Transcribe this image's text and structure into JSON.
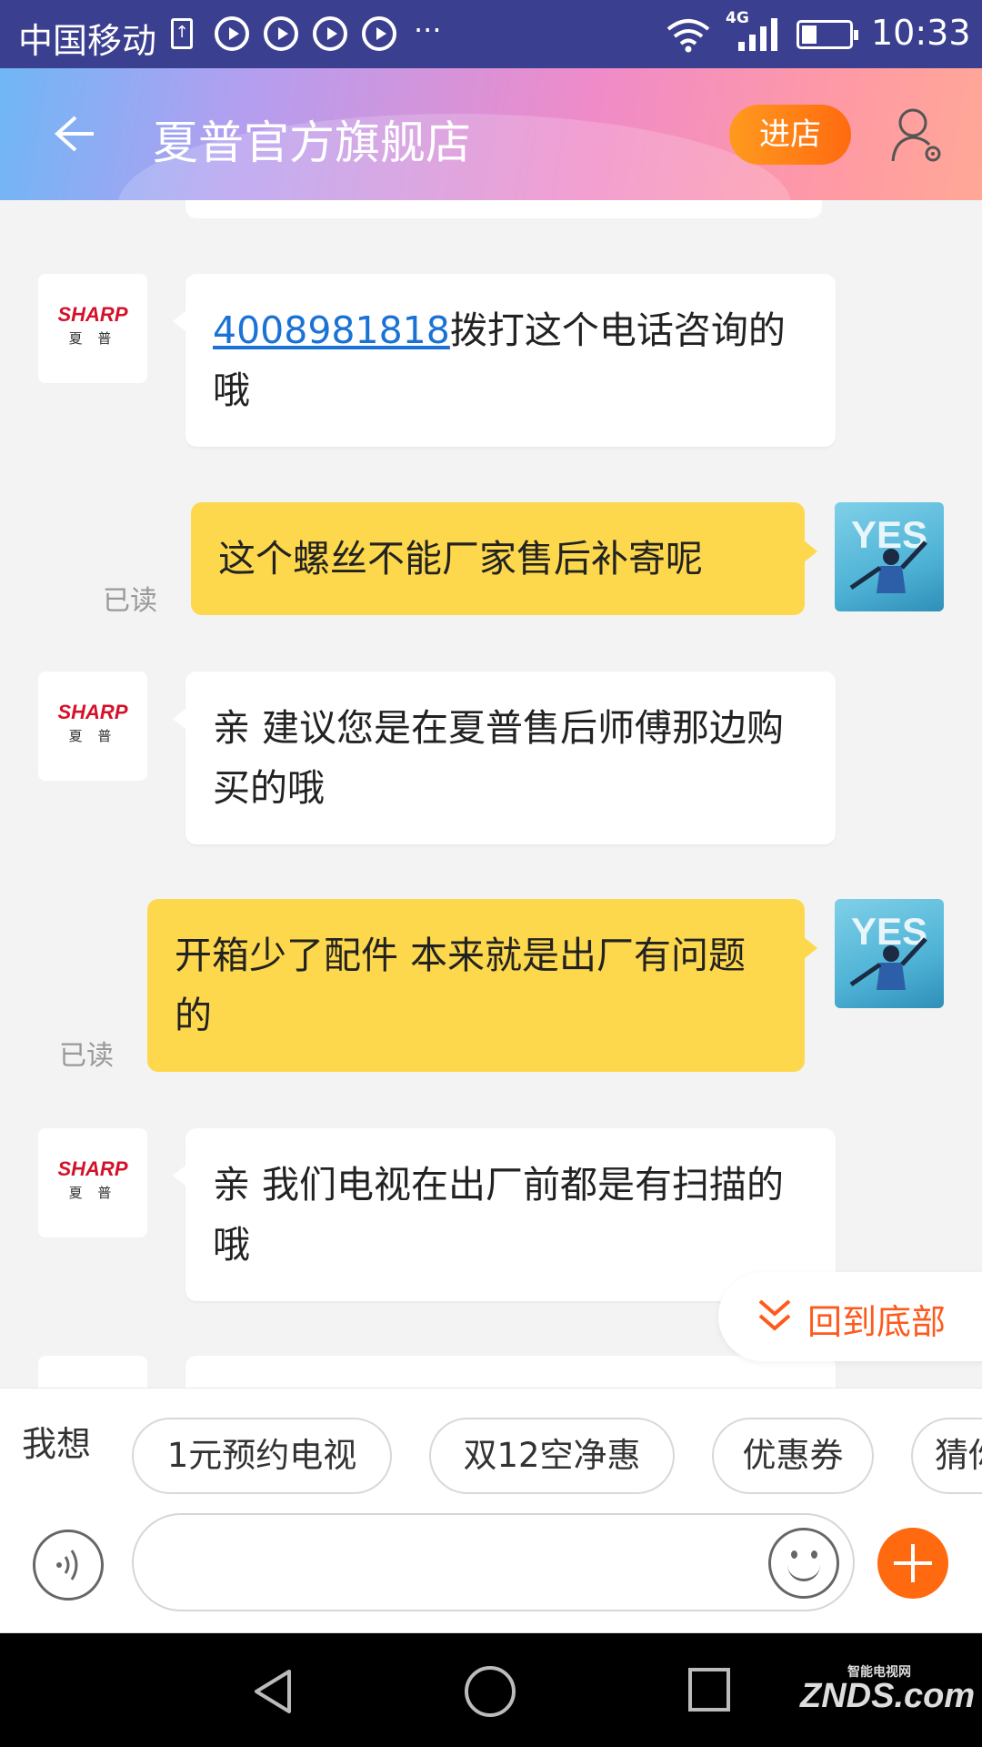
{
  "status_bar": {
    "carrier": "中国移动",
    "network_type": "4G",
    "time": "10:33"
  },
  "header": {
    "title": "夏普官方旗舰店",
    "enter_store_label": "进店"
  },
  "shop_avatar": {
    "brand": "SHARP",
    "brand_cn": "夏 普"
  },
  "user_avatar": {
    "text": "YES"
  },
  "messages": [
    {
      "side": "left",
      "link": "4008981818",
      "text": "拨打这个电话咨询的哦"
    },
    {
      "side": "right",
      "text": "这个螺丝不能厂家售后补寄呢",
      "status": "已读"
    },
    {
      "side": "left",
      "text": "亲 建议您是在夏普售后师傅那边购买的哦"
    },
    {
      "side": "right",
      "text": "开箱少了配件  本来就是出厂有问题的",
      "status": "已读"
    },
    {
      "side": "left",
      "text": "亲 我们电视在出厂前都是有扫描的哦"
    }
  ],
  "back_to_bottom_label": "回到底部",
  "quick_replies": {
    "label": "我想",
    "chips": [
      "1元预约电视",
      "双12空净惠",
      "优惠券",
      "猜你"
    ]
  },
  "input": {
    "placeholder": ""
  },
  "watermark": {
    "cn": "智能电视网",
    "en": "ZNDS.com"
  },
  "colors": {
    "status_bar": "#3b3f8f",
    "accent_orange": "#ff6a10",
    "my_bubble": "#fdd84c",
    "link": "#1a73d4"
  }
}
